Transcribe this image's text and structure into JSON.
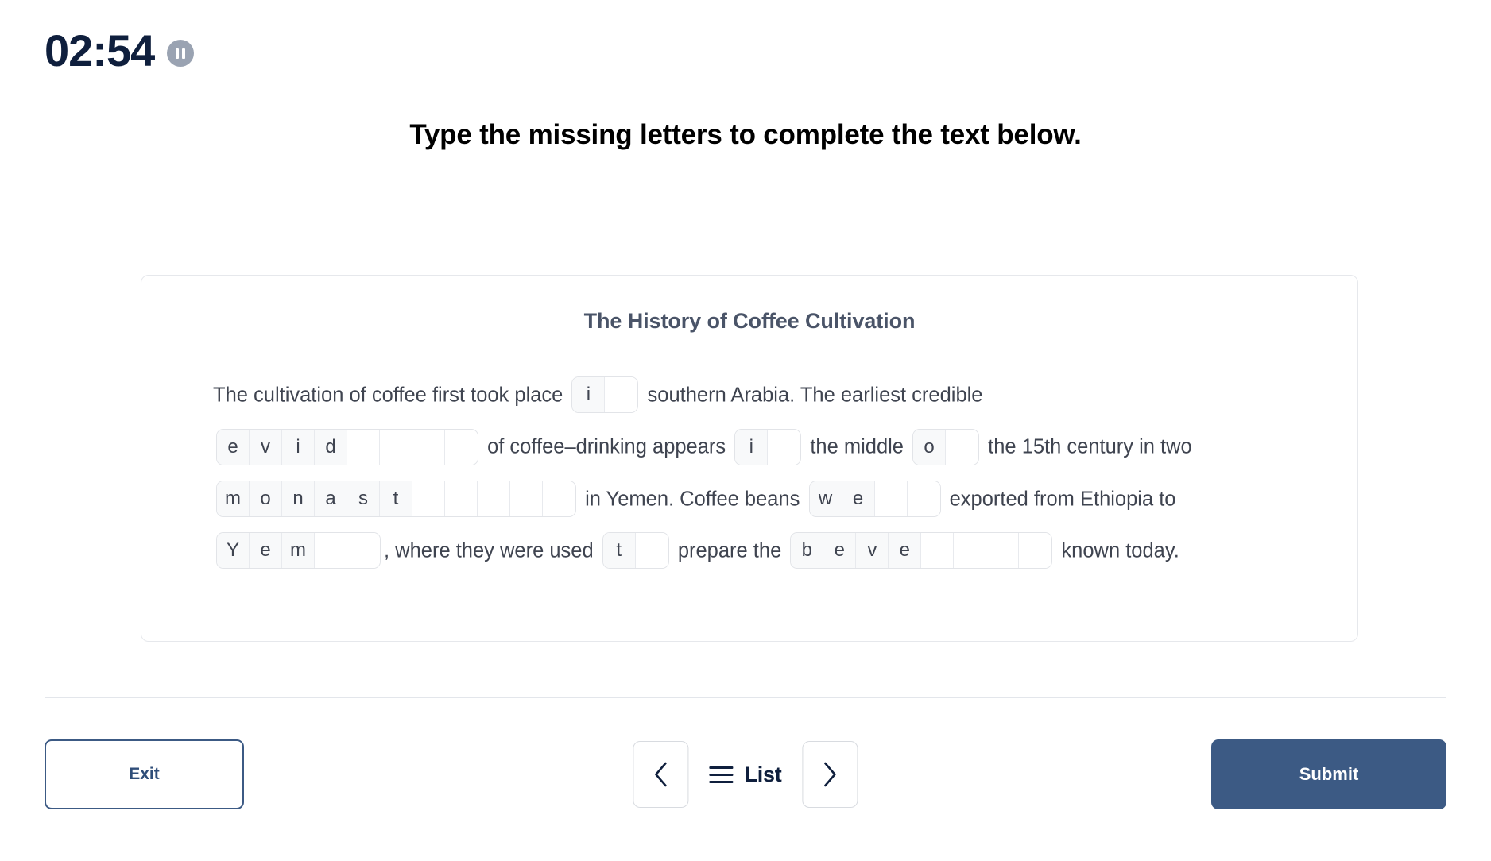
{
  "timer": {
    "value": "02:54",
    "pause_icon": "pause-icon"
  },
  "prompt": {
    "title": "Type the missing letters to complete the text below."
  },
  "card": {
    "title": "The History of Coffee Cultivation",
    "lines": [
      [
        {
          "type": "text",
          "value": "The cultivation of coffee first took place"
        },
        {
          "type": "word",
          "length": 2,
          "filled": "i"
        },
        {
          "type": "text",
          "value": "southern Arabia. The earliest credible"
        }
      ],
      [
        {
          "type": "word",
          "length": 8,
          "filled": "evid"
        },
        {
          "type": "text",
          "value": "of coffee–drinking appears"
        },
        {
          "type": "word",
          "length": 2,
          "filled": "i"
        },
        {
          "type": "text",
          "value": "the middle"
        },
        {
          "type": "word",
          "length": 2,
          "filled": "o"
        },
        {
          "type": "text",
          "value": "the 15th century in two"
        }
      ],
      [
        {
          "type": "word",
          "length": 11,
          "filled": "monast"
        },
        {
          "type": "text",
          "value": "in Yemen. Coffee beans"
        },
        {
          "type": "word",
          "length": 4,
          "filled": "we"
        },
        {
          "type": "text",
          "value": "exported from Ethiopia to"
        }
      ],
      [
        {
          "type": "word",
          "length": 5,
          "filled": "Yem"
        },
        {
          "type": "text",
          "value": ",  where they were used"
        },
        {
          "type": "word",
          "length": 2,
          "filled": "t"
        },
        {
          "type": "text",
          "value": "prepare the"
        },
        {
          "type": "word",
          "length": 8,
          "filled": "beve"
        },
        {
          "type": "text",
          "value": "known today."
        }
      ]
    ]
  },
  "footer": {
    "exit_label": "Exit",
    "prev_icon": "chevron-left-icon",
    "list_icon": "hamburger-icon",
    "list_label": "List",
    "next_icon": "chevron-right-icon",
    "submit_label": "Submit"
  },
  "colors": {
    "accent": "#3c5a84",
    "timer_text": "#0f1f3d",
    "card_title": "#4a5468",
    "body_text": "#3f4450",
    "border": "#e6e8ec",
    "pause_bg": "#9aa3b2"
  }
}
